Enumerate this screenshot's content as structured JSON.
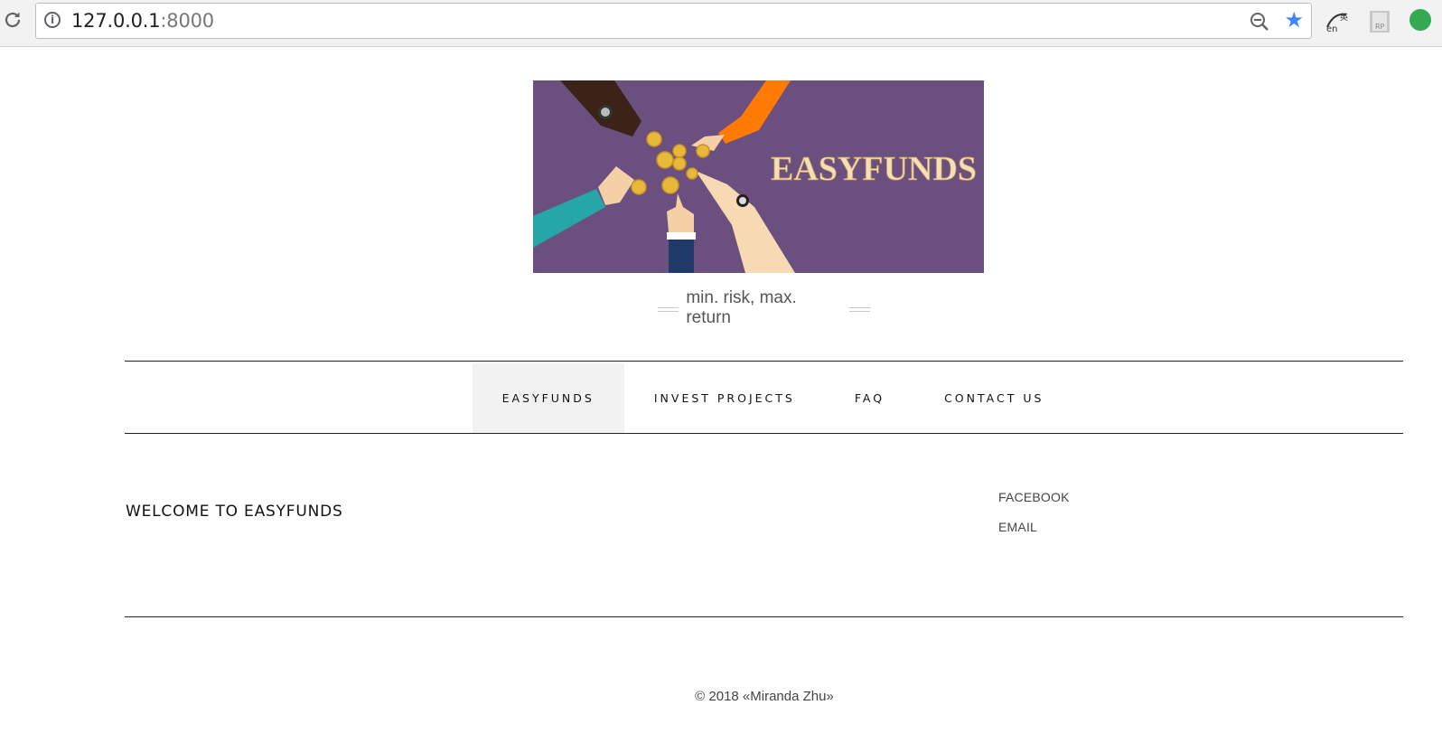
{
  "browser": {
    "url_host": "127.0.0.1",
    "url_port": ":8000",
    "icons": [
      "reload-icon",
      "info-icon",
      "zoom-out-icon",
      "bookmark-star-icon",
      "translate-extension-icon",
      "rp-extension-icon",
      "green-extension-icon"
    ],
    "colors": {
      "star": "#4285f4"
    }
  },
  "banner": {
    "title": "EASYFUNDS",
    "background": "#6b4f7f"
  },
  "tagline": "min. risk, max. return",
  "nav": {
    "items": [
      {
        "label": "EASYFUNDS",
        "active": true
      },
      {
        "label": "INVEST PROJECTS",
        "active": false
      },
      {
        "label": "FAQ",
        "active": false
      },
      {
        "label": "CONTACT US",
        "active": false
      }
    ]
  },
  "main": {
    "heading": "WELCOME TO EASYFUNDS"
  },
  "sidebar": {
    "links": [
      "FACEBOOK",
      "EMAIL"
    ]
  },
  "footer": {
    "copyright": "© 2018 «Miranda Zhu»"
  }
}
